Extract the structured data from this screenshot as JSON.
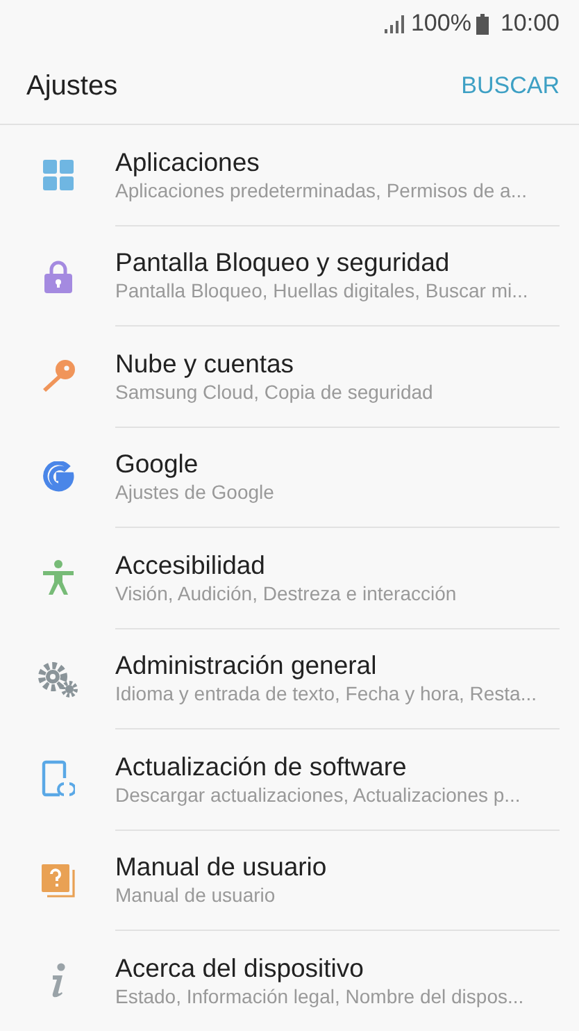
{
  "status_bar": {
    "battery": "100%",
    "time": "10:00"
  },
  "header": {
    "title": "Ajustes",
    "action": "BUSCAR"
  },
  "items": [
    {
      "kind": "apps",
      "title": "Aplicaciones",
      "subtitle": "Aplicaciones predeterminadas, Permisos de a..."
    },
    {
      "kind": "lock",
      "title": "Pantalla Bloqueo y seguridad",
      "subtitle": "Pantalla Bloqueo, Huellas digitales, Buscar mi..."
    },
    {
      "kind": "key",
      "title": "Nube y cuentas",
      "subtitle": "Samsung Cloud, Copia de seguridad"
    },
    {
      "kind": "google",
      "title": "Google",
      "subtitle": "Ajustes de Google"
    },
    {
      "kind": "accessibility",
      "title": "Accesibilidad",
      "subtitle": "Visión, Audición, Destreza e interacción"
    },
    {
      "kind": "gears",
      "title": "Administración general",
      "subtitle": "Idioma y entrada de texto, Fecha y hora, Resta..."
    },
    {
      "kind": "update",
      "title": "Actualización de software",
      "subtitle": "Descargar actualizaciones, Actualizaciones p..."
    },
    {
      "kind": "manual",
      "title": "Manual de usuario",
      "subtitle": "Manual de usuario"
    },
    {
      "kind": "info",
      "title": "Acerca del dispositivo",
      "subtitle": "Estado, Información legal, Nombre del dispos..."
    }
  ]
}
